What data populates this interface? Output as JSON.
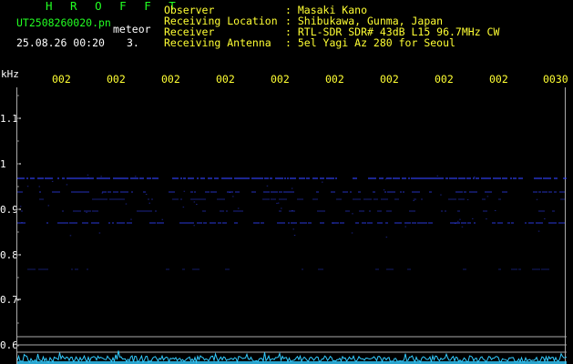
{
  "header": {
    "title": "H R O F F T",
    "filename": "UT2508260020.pn",
    "meteor_label": "meteor",
    "datetime": "25.08.26 00:20",
    "count": "3.",
    "observer_label": "Observer",
    "observer_value": ": Masaki Kano",
    "location_label": "Receiving Location",
    "location_value": ": Shibukawa, Gunma, Japan",
    "receiver_label": "Receiver",
    "receiver_value": ": RTL-SDR SDR# 43dB L15 96.7MHz CW",
    "antenna_label": "Receiving Antenna",
    "antenna_value": ": 5el Yagi Az 280 for Seoul"
  },
  "axis": {
    "y_unit": "kHz",
    "y_ticks": [
      "1.1",
      "1",
      "0.9",
      "0.8",
      "0.7",
      "0.6"
    ],
    "x_ticks": [
      "002",
      "002",
      "002",
      "002",
      "002",
      "002",
      "002",
      "002",
      "002",
      "0030"
    ]
  },
  "colors": {
    "header_yellow": "#ffff33",
    "header_green": "#22ff22",
    "signal_blue": "#3344ff",
    "noise_cyan": "#33ccff"
  }
}
